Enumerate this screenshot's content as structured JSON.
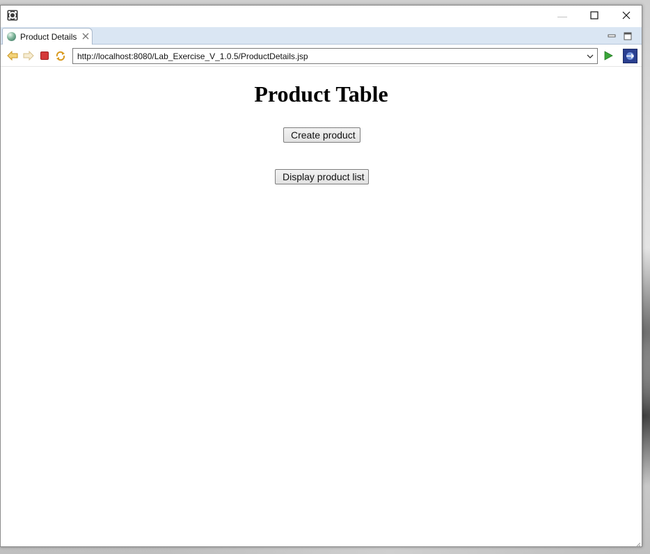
{
  "window": {
    "minimize_glyph": "—",
    "maximize_glyph": "☐",
    "close_glyph": "✕"
  },
  "tabs": [
    {
      "label": "Product Details",
      "icon": "globe-icon",
      "close_glyph": "✕"
    }
  ],
  "toolbar": {
    "back_icon": "back-arrow-icon",
    "forward_icon": "forward-arrow-icon",
    "stop_icon": "stop-icon",
    "refresh_icon": "refresh-icon",
    "go_icon": "go-icon",
    "open_external_icon": "open-external-browser-icon"
  },
  "address": {
    "url": "http://localhost:8080/Lab_Exercise_V_1.0.5/ProductDetails.jsp"
  },
  "page": {
    "title": "Product Table",
    "buttons": {
      "create": "Create product",
      "display": "Display product list"
    }
  },
  "colors": {
    "tabbar_bg": "#dae6f3",
    "back_arrow": "#e8b53a",
    "stop": "#d43a3a",
    "go": "#3aa53a"
  }
}
